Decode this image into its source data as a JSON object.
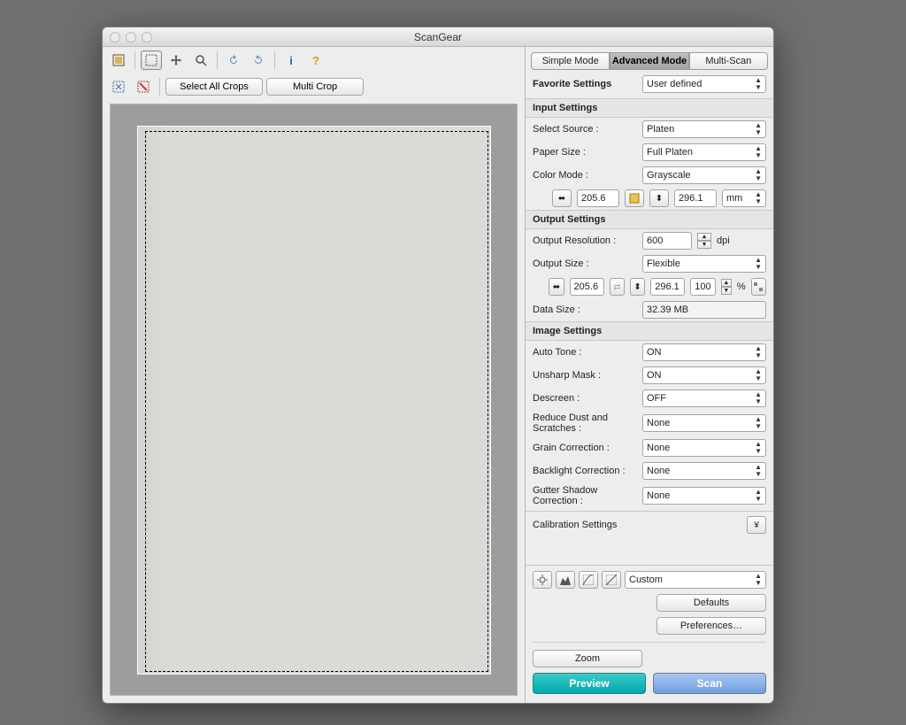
{
  "window": {
    "title": "ScanGear"
  },
  "tabs": {
    "simple": "Simple Mode",
    "advanced": "Advanced Mode",
    "multi": "Multi-Scan"
  },
  "favorite": {
    "label": "Favorite Settings",
    "value": "User defined"
  },
  "cropbar": {
    "select_all": "Select All Crops",
    "multi_crop": "Multi Crop"
  },
  "sections": {
    "input": "Input Settings",
    "output": "Output Settings",
    "image": "Image Settings",
    "calib": "Calibration Settings"
  },
  "input": {
    "source_label": "Select Source :",
    "source": "Platen",
    "paper_label": "Paper Size :",
    "paper": "Full Platen",
    "color_label": "Color Mode :",
    "color": "Grayscale",
    "w": "205.6",
    "h": "296.1",
    "unit": "mm"
  },
  "output": {
    "res_label": "Output Resolution :",
    "res": "600",
    "res_unit": "dpi",
    "size_label": "Output Size :",
    "size": "Flexible",
    "w": "205.6",
    "h": "296.1",
    "scale": "100",
    "scale_unit": "%",
    "data_label": "Data Size :",
    "data": "32.39 MB"
  },
  "image": {
    "auto_tone_l": "Auto Tone :",
    "auto_tone": "ON",
    "unsharp_l": "Unsharp Mask :",
    "unsharp": "ON",
    "descreen_l": "Descreen :",
    "descreen": "OFF",
    "dust_l": "Reduce Dust and Scratches :",
    "dust": "None",
    "grain_l": "Grain Correction :",
    "grain": "None",
    "backlight_l": "Backlight Correction :",
    "backlight": "None",
    "gutter_l": "Gutter Shadow Correction :",
    "gutter": "None"
  },
  "adjust": {
    "preset": "Custom"
  },
  "buttons": {
    "defaults": "Defaults",
    "prefs": "Preferences…",
    "zoom": "Zoom",
    "preview": "Preview",
    "scan": "Scan"
  }
}
